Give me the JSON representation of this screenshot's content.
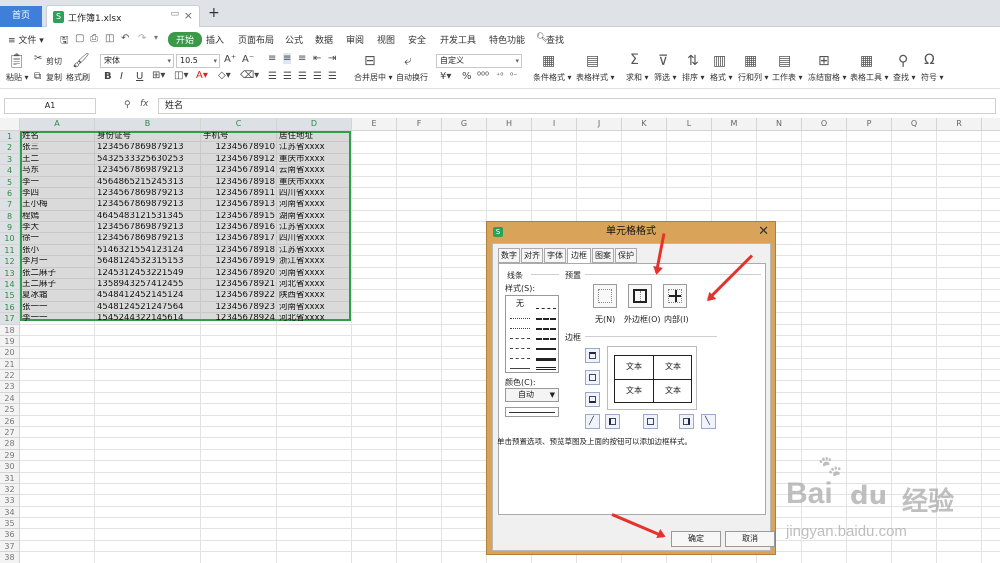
{
  "tabs": {
    "home": "首页",
    "file": "工作簿1.xlsx",
    "add": "+"
  },
  "menu": {
    "file": "≡ 文件 ▾",
    "items": [
      "开始",
      "插入",
      "页面布局",
      "公式",
      "数据",
      "审阅",
      "视图",
      "安全",
      "开发工具",
      "特色功能",
      "查找"
    ]
  },
  "ribbon": {
    "paste": "粘贴 ▾",
    "cut": "剪切",
    "copy": "复制",
    "format_painter": "格式刷",
    "font": "宋体",
    "size": "10.5",
    "number_format": "自定义",
    "merge": "合并居中 ▾",
    "wrap": "自动换行",
    "right_labels": [
      "条件格式 ▾",
      "表格样式 ▾",
      "求和 ▾",
      "筛选 ▾",
      "排序 ▾",
      "格式 ▾",
      "行和列 ▾",
      "工作表 ▾",
      "冻结窗格 ▾",
      "表格工具 ▾",
      "查找 ▾",
      "符号 ▾"
    ]
  },
  "formula_bar": {
    "cell_ref": "A1",
    "fx": "fx",
    "value": "姓名"
  },
  "sheet": {
    "columns": [
      "A",
      "B",
      "C",
      "D",
      "E",
      "F",
      "G",
      "H",
      "I",
      "J",
      "K",
      "L",
      "M",
      "N",
      "O",
      "P",
      "Q",
      "R",
      "S"
    ],
    "rows": [
      [
        "姓名",
        "身份证号",
        "手机号",
        "居住地址"
      ],
      [
        "张三",
        "1234567869879213",
        "12345678910",
        "江苏省xxxx"
      ],
      [
        "王二",
        "5432533325630253",
        "12345678912",
        "重庆市xxxx"
      ],
      [
        "马东",
        "1234567869879213",
        "12345678914",
        "云南省xxxx"
      ],
      [
        "李一",
        "4564865215245313",
        "12345678918",
        "重庆市xxxx"
      ],
      [
        "李四",
        "1234567869879213",
        "12345678911",
        "四川省xxxx"
      ],
      [
        "王小梅",
        "1234567869879213",
        "12345678913",
        "河南省xxxx"
      ],
      [
        "程嫣",
        "4645483121531345",
        "12345678915",
        "湖南省xxxx"
      ],
      [
        "李大",
        "1234567869879213",
        "12345678916",
        "江苏省xxxx"
      ],
      [
        "徐一",
        "1234567869879213",
        "12345678917",
        "四川省xxxx"
      ],
      [
        "张小",
        "5146321554123124",
        "12345678918",
        "江苏省xxxx"
      ],
      [
        "李月一",
        "5648124532315153",
        "12345678919",
        "浙江省xxxx"
      ],
      [
        "张二麻子",
        "1245312453221549",
        "12345678920",
        "河南省xxxx"
      ],
      [
        "王二麻子",
        "1358943257412455",
        "12345678921",
        "河北省xxxx"
      ],
      [
        "夏冰霜",
        "4548412452145124",
        "12345678922",
        "陕西省xxxx"
      ],
      [
        "张一一",
        "4548124521247564",
        "12345678923",
        "河南省xxxx"
      ],
      [
        "李一一",
        "1545244322145614",
        "12345678924",
        "河北省xxxx"
      ]
    ],
    "row_numbers": [
      "1",
      "2",
      "3",
      "4",
      "5",
      "6",
      "7",
      "8",
      "9",
      "10",
      "11",
      "12",
      "13",
      "14",
      "15",
      "16",
      "17",
      "18",
      "19",
      "20",
      "21",
      "22",
      "23",
      "24",
      "25",
      "26",
      "27",
      "28",
      "29",
      "30",
      "31",
      "32",
      "33",
      "34",
      "35",
      "36",
      "37",
      "38"
    ]
  },
  "dialog": {
    "title": "单元格格式",
    "close": "✕",
    "tabs": [
      "数字",
      "对齐",
      "字体",
      "边框",
      "图案",
      "保护"
    ],
    "line_group": "线条",
    "style_label": "样式(S):",
    "style_none": "无",
    "color_label": "颜色(C):",
    "color_value": "自动",
    "preset_group": "预置",
    "presets": [
      "无(N)",
      "外边框(O)",
      "内部(I)"
    ],
    "border_group": "边框",
    "preview_text": "文本",
    "hint": "单击预置选项、预览草图及上面的按钮可以添加边框样式。",
    "ok": "确定",
    "cancel": "取消"
  },
  "watermark": {
    "brand": "Bai",
    "brand2": "经验",
    "url": "jingyan.baidu.com"
  }
}
